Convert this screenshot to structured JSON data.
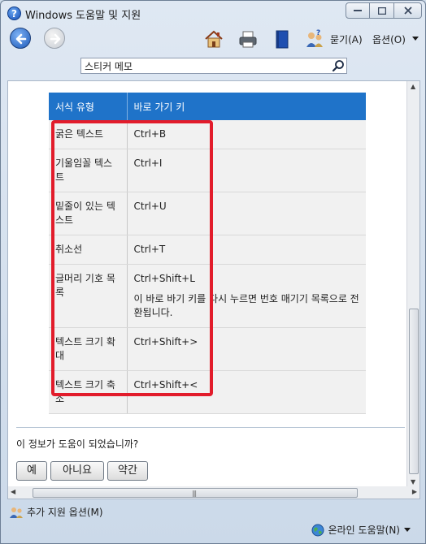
{
  "window": {
    "title": "Windows 도움말 및 지원"
  },
  "toolbar": {
    "ask_label": "묻기(A)",
    "options_label": "옵션(O)"
  },
  "search": {
    "value": "스티커 메모"
  },
  "table": {
    "headers": [
      "서식 유형",
      "바로 가기 키"
    ],
    "rows": [
      {
        "type": "굵은 텍스트",
        "key": "Ctrl+B"
      },
      {
        "type": "기울임꼴 텍스트",
        "key": "Ctrl+I"
      },
      {
        "type": "밑줄이 있는 텍스트",
        "key": "Ctrl+U"
      },
      {
        "type": "취소선",
        "key": "Ctrl+T"
      },
      {
        "type": "글머리 기호 목록",
        "key": "Ctrl+Shift+L",
        "note": "이 바로 바기 키를 다시 누르면 번호 매기기 목록으로 전환됩니다."
      },
      {
        "type": "텍스트 크기 확대",
        "key": "Ctrl+Shift+>"
      },
      {
        "type": "텍스트 크기 축소",
        "key": "Ctrl+Shift+<"
      }
    ]
  },
  "feedback": {
    "question": "이 정보가 도움이 되었습니까?",
    "yes": "예",
    "no": "아니요",
    "somewhat": "약간"
  },
  "status": {
    "more_support": "추가 지원 옵션(M)",
    "online_help": "온라인 도움말(N)"
  }
}
